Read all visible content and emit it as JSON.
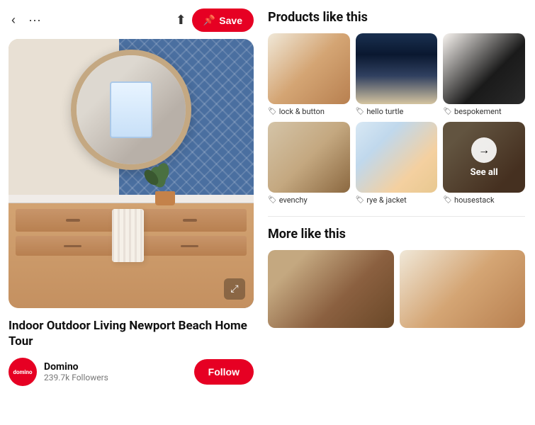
{
  "header": {
    "back_label": "‹",
    "more_label": "···",
    "share_label": "⬆",
    "save_label": "Save",
    "pin_icon": "📌"
  },
  "pin": {
    "title": "Indoor Outdoor Living Newport Beach Home Tour",
    "expand_icon": "⤢"
  },
  "profile": {
    "name": "Domino",
    "followers": "239.7k Followers",
    "avatar_text": "domino",
    "follow_label": "Follow"
  },
  "products": {
    "section_title": "Products like this",
    "items": [
      {
        "id": "lock-button",
        "label": "lock & button",
        "img_class": "mini-bath-1"
      },
      {
        "id": "hello-turtle",
        "label": "hello turtle",
        "img_class": "mini-bath-2"
      },
      {
        "id": "bespokement",
        "label": "bespokement",
        "img_class": "mini-bath-3"
      },
      {
        "id": "evenchy",
        "label": "evenchy",
        "img_class": "mini-bath-4"
      },
      {
        "id": "rye-jacket",
        "label": "rye & jacket",
        "img_class": "mini-bath-5"
      },
      {
        "id": "see-all",
        "label": "housestack",
        "img_class": "see-all",
        "see_all": true
      }
    ],
    "see_all_text": "See all",
    "see_all_arrow": "→"
  },
  "more": {
    "section_title": "More like this",
    "items": [
      {
        "id": "more-1",
        "img_class": "mini-bath-bg"
      },
      {
        "id": "more-2",
        "img_class": "mini-bath-1"
      }
    ]
  }
}
